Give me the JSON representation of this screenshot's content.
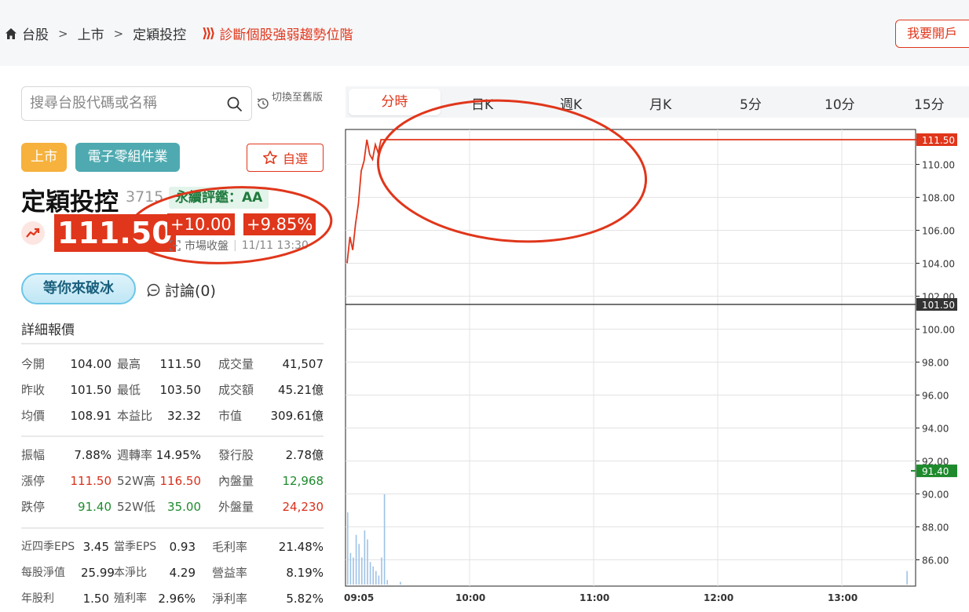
{
  "breadcrumb": {
    "items": [
      "台股",
      "上市",
      "定穎投控"
    ],
    "promo_arrows": "⟩⟩⟩",
    "promo_text": "診斷個股強弱趨勢位階"
  },
  "open_account_label": "我要開戶",
  "search": {
    "placeholder": "搜尋台股代碼或名稱"
  },
  "switch_old_label": "切換至舊版",
  "tags": {
    "market": "上市",
    "industry": "電子零組件業"
  },
  "watch_label": "自選",
  "stock": {
    "name": "定穎投控",
    "code": "3715",
    "esg": "永續評鑑：AA",
    "price": "111.50",
    "change": "+10.00",
    "change_pct": "+9.85%",
    "status": "市場收盤",
    "timestamp": "11/11 13:30"
  },
  "icebreak_label": "等你來破冰",
  "discuss_label": "討論(0)",
  "detail_title": "詳細報價",
  "details": {
    "group1": [
      [
        "今開",
        "104.00",
        "最高",
        "111.50",
        "成交量",
        "41,507"
      ],
      [
        "昨收",
        "101.50",
        "最低",
        "103.50",
        "成交額",
        "45.21億"
      ],
      [
        "均價",
        "108.91",
        "本益比",
        "32.32",
        "市值",
        "309.61億"
      ]
    ],
    "group2": [
      [
        "振幅",
        "7.88%",
        "週轉率",
        "14.95%",
        "發行股",
        "2.78億"
      ],
      [
        "漲停",
        "111.50",
        "52W高",
        "116.50",
        "內盤量",
        "12,968"
      ],
      [
        "跌停",
        "91.40",
        "52W低",
        "35.00",
        "外盤量",
        "24,230"
      ]
    ],
    "group3": [
      [
        "近四季EPS",
        "3.45",
        "當季EPS",
        "0.93",
        "毛利率",
        "21.48%"
      ],
      [
        "每股淨值",
        "25.99",
        "本淨比",
        "4.29",
        "營益率",
        "8.19%"
      ],
      [
        "年股利",
        "1.50",
        "殖利率",
        "2.96%",
        "淨利率",
        "5.82%"
      ]
    ]
  },
  "tabs": [
    "分時",
    "日K",
    "週K",
    "月K",
    "5分",
    "10分",
    "15分"
  ],
  "active_tab": "分時",
  "colors": {
    "up": "#e0361b",
    "down": "#1e8a2d",
    "esg": "#1f7a3e",
    "tag_market": "#f6b23d",
    "tag_industry": "#4eaab0"
  },
  "chart_data": {
    "type": "line",
    "y_ticks": [
      "110.00",
      "108.00",
      "106.00",
      "104.00",
      "102.00",
      "100.00",
      "98.00",
      "96.00",
      "94.00",
      "92.00",
      "90.00",
      "88.00",
      "86.00"
    ],
    "x_ticks": [
      "09:05",
      "10:00",
      "11:00",
      "12:00",
      "13:00"
    ],
    "ylim": [
      84.5,
      111.5
    ],
    "reference_price": 101.5,
    "reference_label": "101.50",
    "last_price": 111.5,
    "last_label": "111.50",
    "limit_down": 91.4,
    "limit_down_label": "91.40",
    "price_series": [
      [
        "09:00",
        104.0
      ],
      [
        "09:01",
        105.6
      ],
      [
        "09:02",
        104.8
      ],
      [
        "09:03",
        106.4
      ],
      [
        "09:04",
        107.6
      ],
      [
        "09:05",
        109.6
      ],
      [
        "09:06",
        110.2
      ],
      [
        "09:07",
        111.5
      ],
      [
        "09:08",
        110.6
      ],
      [
        "09:09",
        110.3
      ],
      [
        "09:10",
        111.2
      ],
      [
        "09:11",
        110.7
      ],
      [
        "09:12",
        111.5
      ],
      [
        "09:15",
        111.5
      ],
      [
        "13:30",
        111.5
      ]
    ],
    "volume_series": [
      [
        "09:00",
        0.8
      ],
      [
        "09:01",
        0.35
      ],
      [
        "09:02",
        0.3
      ],
      [
        "09:03",
        0.55
      ],
      [
        "09:04",
        0.45
      ],
      [
        "09:05",
        0.3
      ],
      [
        "09:06",
        0.6
      ],
      [
        "09:07",
        0.5
      ],
      [
        "09:08",
        0.25
      ],
      [
        "09:09",
        0.2
      ],
      [
        "09:10",
        0.15
      ],
      [
        "09:11",
        0.1
      ],
      [
        "09:12",
        0.3
      ],
      [
        "09:13",
        1.0
      ],
      [
        "09:14",
        0.05
      ],
      [
        "09:20",
        0.03
      ],
      [
        "13:25",
        0.15
      ]
    ]
  }
}
